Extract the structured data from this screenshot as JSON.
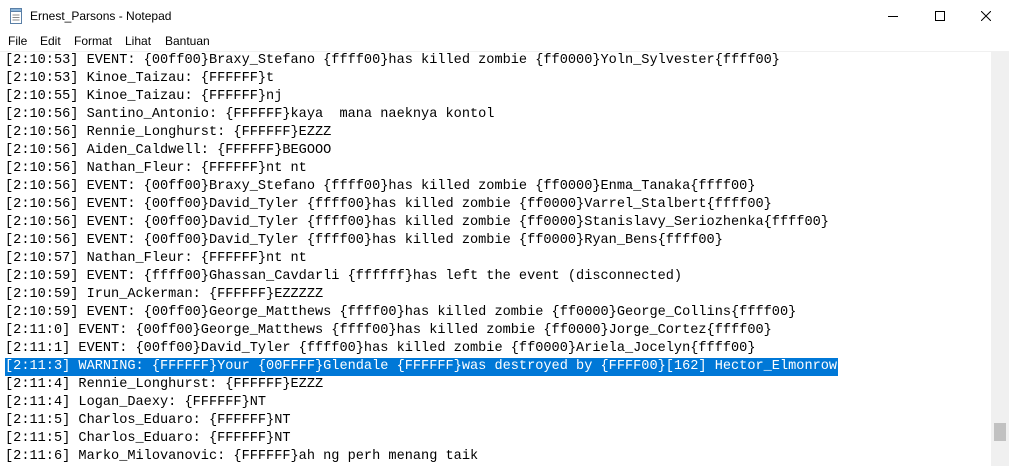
{
  "window": {
    "title": "Ernest_Parsons - Notepad"
  },
  "menu": [
    "File",
    "Edit",
    "Format",
    "Lihat",
    "Bantuan"
  ],
  "editor": {
    "lines": [
      "[2:10:53] EVENT: {00ff00}Braxy_Stefano {ffff00}has killed zombie {ff0000}Yoln_Sylvester{ffff00}",
      "[2:10:53] Kinoe_Taizau: {FFFFFF}t",
      "[2:10:55] Kinoe_Taizau: {FFFFFF}nj",
      "[2:10:56] Santino_Antonio: {FFFFFF}kaya  mana naeknya kontol",
      "[2:10:56] Rennie_Longhurst: {FFFFFF}EZZZ",
      "[2:10:56] Aiden_Caldwell: {FFFFFF}BEGOOO",
      "[2:10:56] Nathan_Fleur: {FFFFFF}nt nt",
      "[2:10:56] EVENT: {00ff00}Braxy_Stefano {ffff00}has killed zombie {ff0000}Enma_Tanaka{ffff00}",
      "[2:10:56] EVENT: {00ff00}David_Tyler {ffff00}has killed zombie {ff0000}Varrel_Stalbert{ffff00}",
      "[2:10:56] EVENT: {00ff00}David_Tyler {ffff00}has killed zombie {ff0000}Stanislavy_Seriozhenka{ffff00}",
      "[2:10:56] EVENT: {00ff00}David_Tyler {ffff00}has killed zombie {ff0000}Ryan_Bens{ffff00}",
      "[2:10:57] Nathan_Fleur: {FFFFFF}nt nt",
      "[2:10:59] EVENT: {ffff00}Ghassan_Cavdarli {ffffff}has left the event (disconnected)",
      "[2:10:59] Irun_Ackerman: {FFFFFF}EZZZZZ",
      "[2:10:59] EVENT: {00ff00}George_Matthews {ffff00}has killed zombie {ff0000}George_Collins{ffff00}",
      "[2:11:0] EVENT: {00ff00}George_Matthews {ffff00}has killed zombie {ff0000}Jorge_Cortez{ffff00}",
      "[2:11:1] EVENT: {00ff00}David_Tyler {ffff00}has killed zombie {ff0000}Ariela_Jocelyn{ffff00}",
      "[2:11:3] WARNING: {FFFFFF}Your {00FFFF}Glendale {FFFFFF}was destroyed by {FFFF00}[162] Hector_Elmonrow",
      "[2:11:4] Rennie_Longhurst: {FFFFFF}EZZZ",
      "[2:11:4] Logan_Daexy: {FFFFFF}NT",
      "[2:11:5] Charlos_Eduaro: {FFFFFF}NT",
      "[2:11:5] Charlos_Eduaro: {FFFFFF}NT",
      "[2:11:6] Marko_Milovanovic: {FFFFFF}ah ng perh menang taik"
    ],
    "selected_line_index": 17
  },
  "colors": {
    "selection": "#0078d7",
    "scrollbar_track": "#f0f0f0",
    "scrollbar_thumb": "#c1c1c1"
  },
  "icons": {
    "app": "notepad-icon",
    "minimize": "minimize-icon",
    "maximize": "maximize-icon",
    "close": "close-icon"
  }
}
